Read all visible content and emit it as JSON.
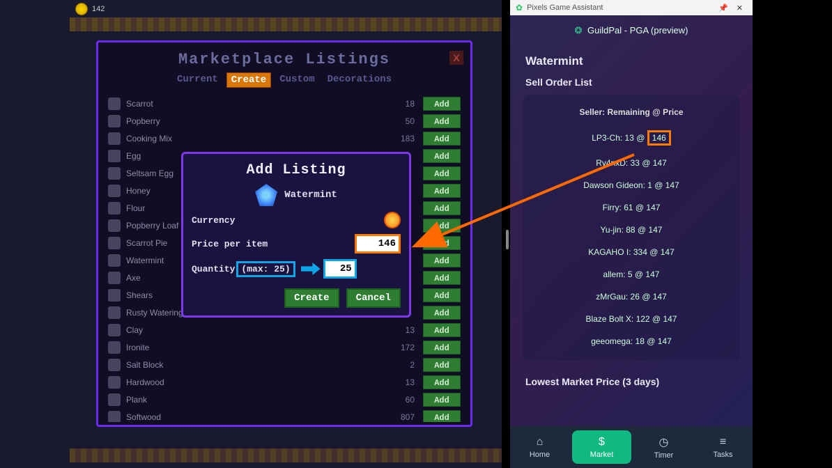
{
  "hud": {
    "value": "142"
  },
  "marketplace": {
    "title": "Marketplace Listings",
    "tabs": [
      "Current",
      "Create",
      "Custom",
      "Decorations"
    ],
    "active_tab": 1,
    "add_label": "Add",
    "close_label": "X",
    "items": [
      {
        "name": "Scarrot",
        "qty": "18"
      },
      {
        "name": "Popberry",
        "qty": "50"
      },
      {
        "name": "Cooking Mix",
        "qty": "183"
      },
      {
        "name": "Egg",
        "qty": ""
      },
      {
        "name": "Seltsam Egg",
        "qty": ""
      },
      {
        "name": "Honey",
        "qty": ""
      },
      {
        "name": "Flour",
        "qty": ""
      },
      {
        "name": "Popberry Loaf",
        "qty": ""
      },
      {
        "name": "Scarrot Pie",
        "qty": ""
      },
      {
        "name": "Watermint",
        "qty": ""
      },
      {
        "name": "Axe",
        "qty": ""
      },
      {
        "name": "Shears",
        "qty": ""
      },
      {
        "name": "Rusty Watering",
        "qty": ""
      },
      {
        "name": "Clay",
        "qty": "13"
      },
      {
        "name": "Ironite",
        "qty": "172"
      },
      {
        "name": "Salt Block",
        "qty": "2"
      },
      {
        "name": "Hardwood",
        "qty": "13"
      },
      {
        "name": "Plank",
        "qty": "60"
      },
      {
        "name": "Softwood",
        "qty": "807"
      }
    ]
  },
  "add_listing": {
    "title": "Add Listing",
    "item_name": "Watermint",
    "currency_label": "Currency",
    "price_label": "Price per item",
    "price_value": "146",
    "quantity_label": "Quantity",
    "max_label": "(max: 25)",
    "quantity_value": "25",
    "create": "Create",
    "cancel": "Cancel"
  },
  "assistant": {
    "window_title": "Pixels Game Assistant",
    "brand": "GuildPal - PGA (preview)",
    "item": "Watermint",
    "section_title": "Sell Order List",
    "table_header": "Seller: Remaining @ Price",
    "highlight_price": "146",
    "orders": [
      {
        "seller": "LP3-Ch",
        "remain": "13",
        "price": "146"
      },
      {
        "seller": "Ry4nxD",
        "remain": "33",
        "price": "147"
      },
      {
        "seller": "Dawson Gideon",
        "remain": "1",
        "price": "147"
      },
      {
        "seller": "Firry",
        "remain": "61",
        "price": "147"
      },
      {
        "seller": "Yu-jin",
        "remain": "88",
        "price": "147"
      },
      {
        "seller": "KAGAHO I",
        "remain": "334",
        "price": "147"
      },
      {
        "seller": "allem",
        "remain": "5",
        "price": "147"
      },
      {
        "seller": "zMrGau",
        "remain": "26",
        "price": "147"
      },
      {
        "seller": "Blaze Bolt X",
        "remain": "122",
        "price": "147"
      },
      {
        "seller": "geeomega",
        "remain": "18",
        "price": "147"
      }
    ],
    "lowest_label": "Lowest Market Price (3 days)",
    "nav": [
      {
        "icon": "⌂",
        "label": "Home"
      },
      {
        "icon": "$",
        "label": "Market"
      },
      {
        "icon": "◷",
        "label": "Timer"
      },
      {
        "icon": "≡",
        "label": "Tasks"
      }
    ],
    "nav_active": 1
  }
}
